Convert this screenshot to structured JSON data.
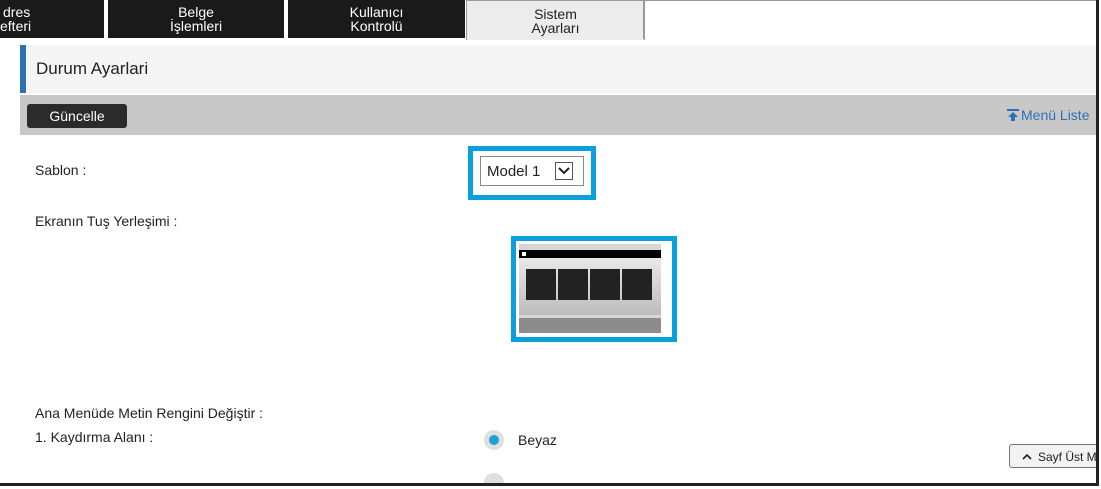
{
  "tabs": [
    {
      "line1": "dres",
      "line2": "efteri"
    },
    {
      "line1": "Belge",
      "line2": "İşlemleri"
    },
    {
      "line1": "Kullanıcı",
      "line2": "Kontrolü"
    },
    {
      "line1": "Sistem",
      "line2": "Ayarları"
    }
  ],
  "active_tab": 3,
  "page_title": "Durum Ayarlari",
  "toolbar": {
    "update_label": "Güncelle",
    "menu_list_label": "Menü Liste"
  },
  "form": {
    "template_label": "Sablon :",
    "template_value": "Model 1",
    "key_layout_label": "Ekranın Tuş Yerleşimi :",
    "text_color_label": "Ana Menüde Metin Rengini Değiştir :",
    "scroll_area_label": "1. Kaydırma Alanı :",
    "radio_white_label": "Beyaz",
    "radio_white_selected": true
  },
  "page_top_label": "Sayf Üst Men",
  "colors": {
    "accent": "#2a73b3",
    "highlight": "#0aa0dc",
    "tab_dark": "#1a1a1a",
    "radio_selected": "#1ea0d8"
  }
}
